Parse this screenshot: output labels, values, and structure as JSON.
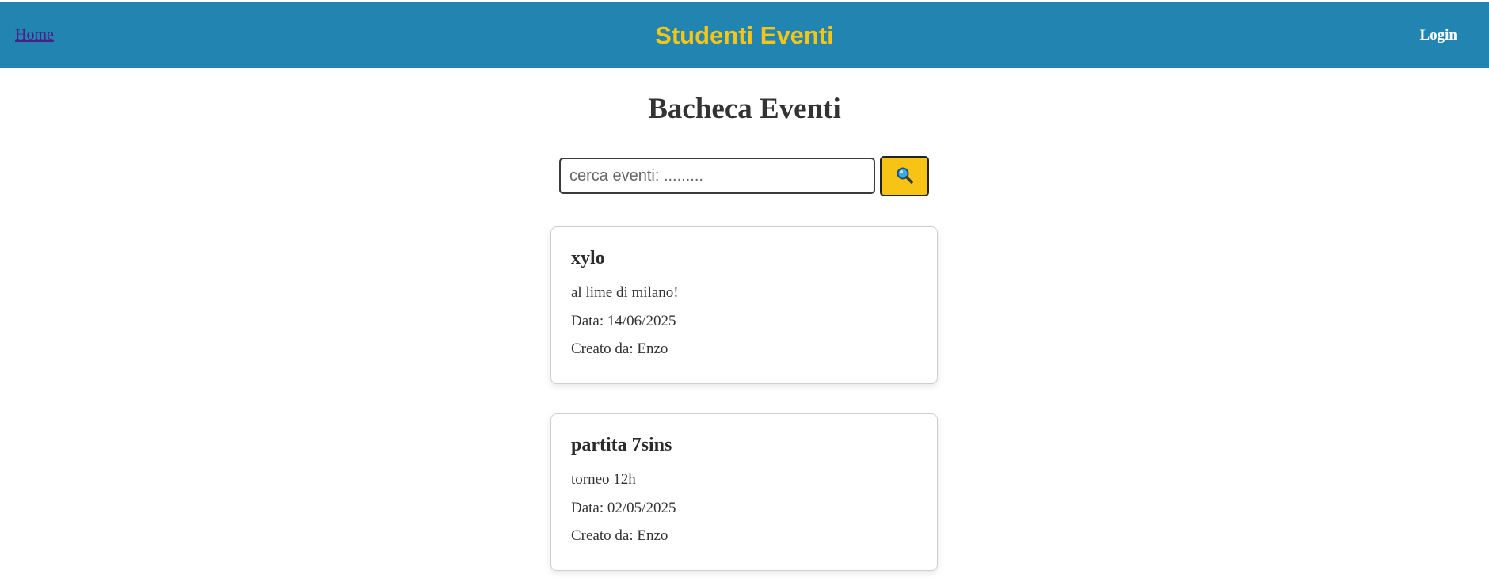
{
  "header": {
    "home_label": "Home",
    "brand": "Studenti Eventi",
    "login_label": "Login",
    "bg_color": "#2285b1",
    "brand_color": "#f5c518"
  },
  "main": {
    "title": "Bacheca Eventi",
    "search": {
      "placeholder": "cerca eventi: .........",
      "value": "",
      "button_icon": "search-icon",
      "button_color": "#f7c315"
    }
  },
  "events": [
    {
      "title": "xylo",
      "description": "al lime di milano!",
      "date": "Data: 14/06/2025",
      "creator": "Creato da: Enzo"
    },
    {
      "title": "partita 7sins",
      "description": "torneo 12h",
      "date": "Data: 02/05/2025",
      "creator": "Creato da: Enzo"
    }
  ]
}
